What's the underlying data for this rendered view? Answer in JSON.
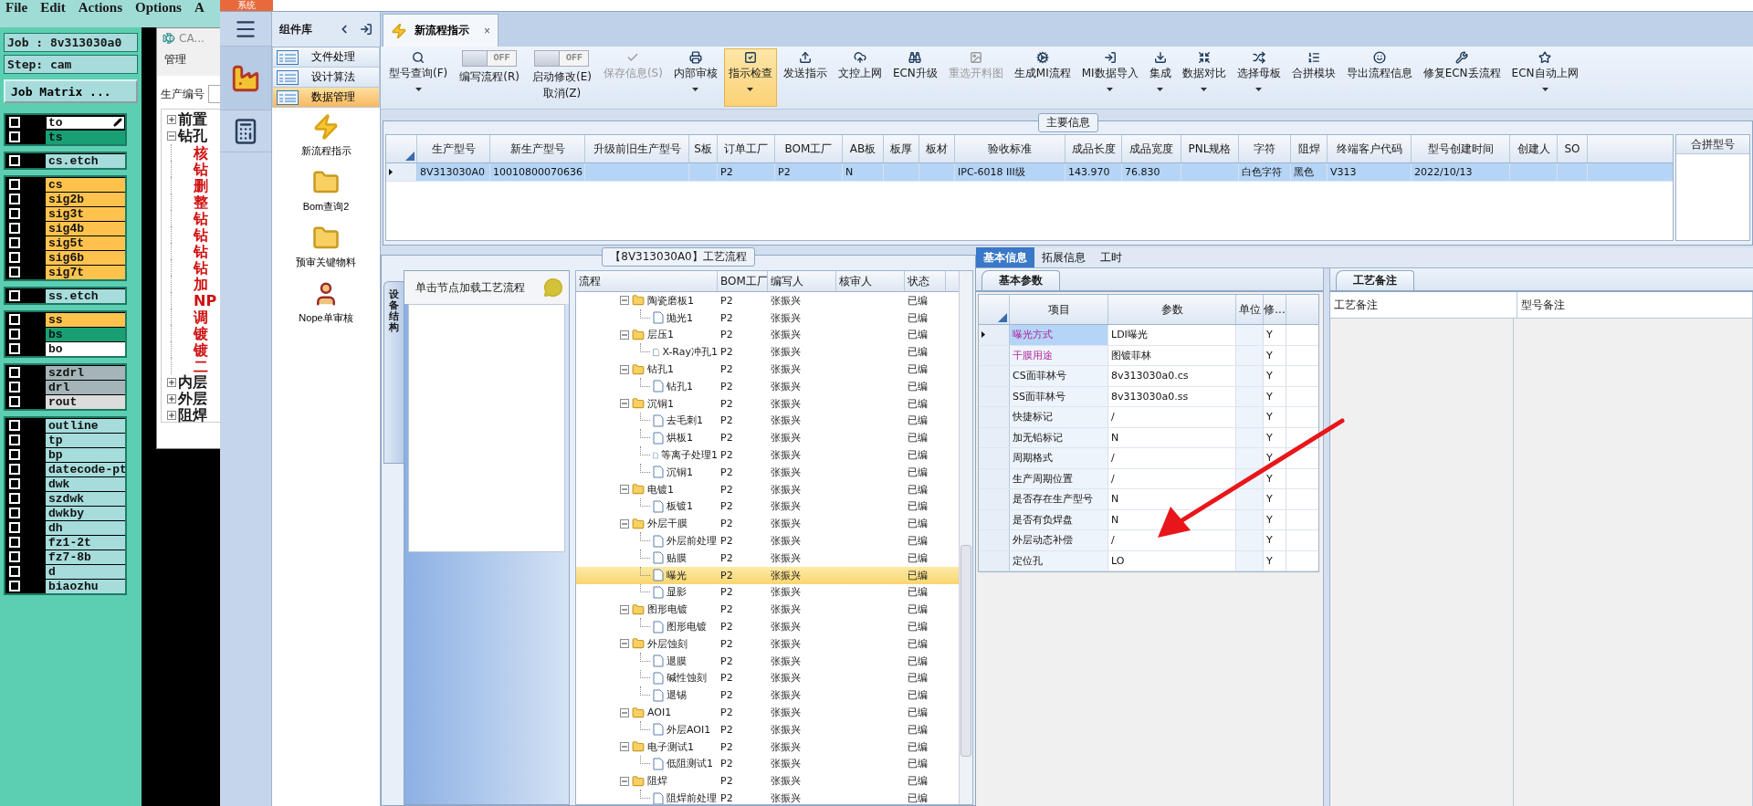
{
  "cam": {
    "menu": [
      "File",
      "Edit",
      "Actions",
      "Options",
      "A"
    ],
    "job": "Job : 8v313030a0",
    "step": "Step: cam",
    "matrix_button": "Job Matrix ...",
    "layer_groups": [
      [
        {
          "name": "to",
          "color": "#ffffff",
          "selected": true,
          "checked": false
        },
        {
          "name": "ts",
          "color": "#18a074",
          "selected": false,
          "checked": false
        }
      ],
      [
        {
          "name": "cs.etch",
          "color": "#a6dcdc",
          "selected": false,
          "checked": false
        }
      ],
      [
        {
          "name": "cs",
          "color": "#ffc34d",
          "selected": false,
          "checked": false
        },
        {
          "name": "sig2b",
          "color": "#ffc34d",
          "selected": false,
          "checked": false
        },
        {
          "name": "sig3t",
          "color": "#ffc34d",
          "selected": false,
          "checked": false
        },
        {
          "name": "sig4b",
          "color": "#ffc34d",
          "selected": false,
          "checked": false
        },
        {
          "name": "sig5t",
          "color": "#ffc34d",
          "selected": false,
          "checked": false
        },
        {
          "name": "sig6b",
          "color": "#ffc34d",
          "selected": false,
          "checked": false
        },
        {
          "name": "sig7t",
          "color": "#ffc34d",
          "selected": false,
          "checked": false
        }
      ],
      [
        {
          "name": "ss.etch",
          "color": "#a6dcdc",
          "selected": false,
          "checked": false
        }
      ],
      [
        {
          "name": "ss",
          "color": "#ffc34d",
          "selected": false,
          "checked": false
        },
        {
          "name": "bs",
          "color": "#18a074",
          "selected": false,
          "checked": false
        },
        {
          "name": "bo",
          "color": "#ffffff",
          "selected": false,
          "checked": false
        }
      ],
      [
        {
          "name": "szdrl",
          "color": "#a4b4b8",
          "selected": false,
          "checked": false
        },
        {
          "name": "drl",
          "color": "#a4b4b8",
          "selected": false,
          "checked": false
        },
        {
          "name": "rout",
          "color": "#dcdcdc",
          "selected": false,
          "checked": false
        }
      ],
      [
        {
          "name": "outline",
          "color": "#a6dcdc",
          "selected": false,
          "checked": false
        },
        {
          "name": "tp",
          "color": "#a6dcdc",
          "selected": false,
          "checked": false
        },
        {
          "name": "bp",
          "color": "#a6dcdc",
          "selected": false,
          "checked": false
        },
        {
          "name": "datecode-pt",
          "color": "#a6dcdc",
          "selected": false,
          "checked": false
        },
        {
          "name": "dwk",
          "color": "#a6dcdc",
          "selected": false,
          "checked": false
        },
        {
          "name": "szdwk",
          "color": "#a6dcdc",
          "selected": false,
          "checked": false
        },
        {
          "name": "dwkby",
          "color": "#a6dcdc",
          "selected": false,
          "checked": false
        },
        {
          "name": "dh",
          "color": "#a6dcdc",
          "selected": false,
          "checked": false
        },
        {
          "name": "fz1-2t",
          "color": "#a6dcdc",
          "selected": false,
          "checked": false
        },
        {
          "name": "fz7-8b",
          "color": "#a6dcdc",
          "selected": false,
          "checked": false
        },
        {
          "name": "d",
          "color": "#a6dcdc",
          "selected": false,
          "checked": false
        },
        {
          "name": "biaozhu",
          "color": "#a6dcdc",
          "selected": false,
          "checked": false
        }
      ]
    ]
  },
  "cam_window": {
    "title": "CA...",
    "menu": [
      "管理"
    ],
    "field_label": "生产编号",
    "tree": [
      {
        "label": "前置",
        "expanded": false
      },
      {
        "label": "钻孔",
        "expanded": true,
        "children": [
          "核",
          "钻",
          "删",
          "整",
          "钻",
          "钻",
          "钻",
          "钻",
          "加",
          "NP",
          "调",
          "镀",
          "镀",
          "二"
        ]
      },
      {
        "label": "内层",
        "expanded": false
      },
      {
        "label": "外层",
        "expanded": false
      },
      {
        "label": "阻焊",
        "expanded": false
      }
    ]
  },
  "system_tab": "系统",
  "component_panel": {
    "title": "组件库",
    "sections": [
      {
        "label": "文件处理",
        "selected": false
      },
      {
        "label": "设计算法",
        "selected": false
      },
      {
        "label": "数据管理",
        "selected": true
      }
    ],
    "items": [
      {
        "label": "新流程指示",
        "kind": "bolt"
      },
      {
        "label": "Bom查询2",
        "kind": "folder"
      },
      {
        "label": "预审关键物料",
        "kind": "folder"
      },
      {
        "label": "Nope单审核",
        "kind": "person"
      }
    ]
  },
  "doc_tabs": [
    {
      "label": "新流程指示",
      "selected": true,
      "close": "×"
    }
  ],
  "toolbar": [
    {
      "kind": "button",
      "label": "型号查询(F)",
      "dropdown": true,
      "disabled": false,
      "selected": false
    },
    {
      "kind": "toggle",
      "on": false,
      "state_text": "OFF",
      "label": "编写流程(R)"
    },
    {
      "kind": "toggle",
      "on": false,
      "state_text": "OFF",
      "label": "启动修改(E)",
      "sub_label": "取消(Z)"
    },
    {
      "kind": "button",
      "label": "保存信息(S)",
      "dropdown": false,
      "disabled": true,
      "selected": false
    },
    {
      "kind": "button",
      "label": "内部审核",
      "dropdown": true,
      "disabled": false,
      "selected": false
    },
    {
      "kind": "button",
      "label": "指示检查",
      "dropdown": true,
      "disabled": false,
      "selected": true
    },
    {
      "kind": "button",
      "label": "发送指示",
      "dropdown": false,
      "disabled": false,
      "selected": false
    },
    {
      "kind": "button",
      "label": "文控上网",
      "dropdown": false,
      "disabled": false,
      "selected": false
    },
    {
      "kind": "button",
      "label": "ECN升级",
      "dropdown": false,
      "disabled": false,
      "selected": false
    },
    {
      "kind": "button",
      "label": "重选开料图",
      "dropdown": false,
      "disabled": true,
      "selected": false
    },
    {
      "kind": "button",
      "label": "生成MI流程",
      "dropdown": false,
      "disabled": false,
      "selected": false
    },
    {
      "kind": "button",
      "label": "MI数据导入",
      "dropdown": true,
      "disabled": false,
      "selected": false
    },
    {
      "kind": "button",
      "label": "集成",
      "dropdown": true,
      "disabled": false,
      "selected": false
    },
    {
      "kind": "button",
      "label": "数据对比",
      "dropdown": true,
      "disabled": false,
      "selected": false
    },
    {
      "kind": "button",
      "label": "选择母板",
      "dropdown": true,
      "disabled": false,
      "selected": false
    },
    {
      "kind": "button",
      "label": "合拼模块",
      "dropdown": false,
      "disabled": false,
      "selected": false
    },
    {
      "kind": "button",
      "label": "导出流程信息",
      "dropdown": false,
      "disabled": false,
      "selected": false
    },
    {
      "kind": "button",
      "label": "修复ECN丢流程",
      "dropdown": false,
      "disabled": false,
      "selected": false
    },
    {
      "kind": "button",
      "label": "ECN自动上网",
      "dropdown": true,
      "disabled": false,
      "selected": false
    }
  ],
  "main_info": {
    "title": "主要信息",
    "columns": [
      "生产型号",
      "新生产型号",
      "升级前旧生产型号",
      "S板",
      "订单工厂",
      "BOM工厂",
      "AB板",
      "板厚",
      "板材",
      "验收标准",
      "成品长度",
      "成品宽度",
      "PNL规格",
      "字符",
      "阻焊",
      "终端客户代码",
      "型号创建时间",
      "创建人",
      "SO"
    ],
    "rows": [
      {
        "selected": true,
        "cells": [
          "8V313030A0",
          "10010800070636",
          null,
          null,
          "P2",
          "P2",
          "N",
          null,
          null,
          "IPC-6018 III级",
          "143.970",
          "76.830",
          null,
          "白色字符",
          "黑色",
          "V313",
          "2022/10/13",
          null,
          null
        ]
      }
    ],
    "side_column": "合拼型号"
  },
  "process": {
    "title": "【8V313030A0】工艺流程",
    "side_tab": "设备结构",
    "hint": "单击节点加载工艺流程",
    "columns": [
      "流程",
      "BOM工厂",
      "编写人",
      "核审人",
      "状态"
    ],
    "tree": [
      {
        "label": "陶瓷磨板1",
        "bom": "P2",
        "writer": "张振兴",
        "status": "已编",
        "expanded": true,
        "selected": false,
        "children": [
          {
            "label": "抛光1",
            "bom": "P2",
            "writer": "张振兴",
            "status": "已编",
            "selected": false
          }
        ]
      },
      {
        "label": "层压1",
        "bom": "P2",
        "writer": "张振兴",
        "status": "已编",
        "expanded": true,
        "selected": false,
        "children": [
          {
            "label": "X-Ray冲孔1",
            "bom": "P2",
            "writer": "张振兴",
            "status": "已编",
            "selected": false
          }
        ]
      },
      {
        "label": "钻孔1",
        "bom": "P2",
        "writer": "张振兴",
        "status": "已编",
        "expanded": true,
        "selected": false,
        "children": [
          {
            "label": "钻孔1",
            "bom": "P2",
            "writer": "张振兴",
            "status": "已编",
            "selected": false
          }
        ]
      },
      {
        "label": "沉铜1",
        "bom": "P2",
        "writer": "张振兴",
        "status": "已编",
        "expanded": true,
        "selected": false,
        "children": [
          {
            "label": "去毛刺1",
            "bom": "P2",
            "writer": "张振兴",
            "status": "已编",
            "selected": false
          },
          {
            "label": "烘板1",
            "bom": "P2",
            "writer": "张振兴",
            "status": "已编",
            "selected": false
          },
          {
            "label": "等离子处理1",
            "bom": "P2",
            "writer": "张振兴",
            "status": "已编",
            "selected": false
          },
          {
            "label": "沉铜1",
            "bom": "P2",
            "writer": "张振兴",
            "status": "已编",
            "selected": false
          }
        ]
      },
      {
        "label": "电镀1",
        "bom": "P2",
        "writer": "张振兴",
        "status": "已编",
        "expanded": true,
        "selected": false,
        "children": [
          {
            "label": "板镀1",
            "bom": "P2",
            "writer": "张振兴",
            "status": "已编",
            "selected": false
          }
        ]
      },
      {
        "label": "外层干膜",
        "bom": "P2",
        "writer": "张振兴",
        "status": "已编",
        "expanded": true,
        "selected": false,
        "children": [
          {
            "label": "外层前处理",
            "bom": "P2",
            "writer": "张振兴",
            "status": "已编",
            "selected": false
          },
          {
            "label": "贴膜",
            "bom": "P2",
            "writer": "张振兴",
            "status": "已编",
            "selected": false
          },
          {
            "label": "曝光",
            "bom": "P2",
            "writer": "张振兴",
            "status": "已编",
            "selected": true
          },
          {
            "label": "显影",
            "bom": "P2",
            "writer": "张振兴",
            "status": "已编",
            "selected": false
          }
        ]
      },
      {
        "label": "图形电镀",
        "bom": "P2",
        "writer": "张振兴",
        "status": "已编",
        "expanded": true,
        "selected": false,
        "children": [
          {
            "label": "图形电镀",
            "bom": "P2",
            "writer": "张振兴",
            "status": "已编",
            "selected": false
          }
        ]
      },
      {
        "label": "外层蚀刻",
        "bom": "P2",
        "writer": "张振兴",
        "status": "已编",
        "expanded": true,
        "selected": false,
        "children": [
          {
            "label": "退膜",
            "bom": "P2",
            "writer": "张振兴",
            "status": "已编",
            "selected": false
          },
          {
            "label": "碱性蚀刻",
            "bom": "P2",
            "writer": "张振兴",
            "status": "已编",
            "selected": false
          },
          {
            "label": "退锡",
            "bom": "P2",
            "writer": "张振兴",
            "status": "已编",
            "selected": false
          }
        ]
      },
      {
        "label": "AOI1",
        "bom": "P2",
        "writer": "张振兴",
        "status": "已编",
        "expanded": true,
        "selected": false,
        "children": [
          {
            "label": "外层AOI1",
            "bom": "P2",
            "writer": "张振兴",
            "status": "已编",
            "selected": false
          }
        ]
      },
      {
        "label": "电子测试1",
        "bom": "P2",
        "writer": "张振兴",
        "status": "已编",
        "expanded": true,
        "selected": false,
        "children": [
          {
            "label": "低阻测试1",
            "bom": "P2",
            "writer": "张振兴",
            "status": "已编",
            "selected": false
          }
        ]
      },
      {
        "label": "阻焊",
        "bom": "P2",
        "writer": "张振兴",
        "status": "已编",
        "expanded": true,
        "selected": false,
        "children": [
          {
            "label": "阻焊前处理",
            "bom": "P2",
            "writer": "张振兴",
            "status": "已编",
            "selected": false
          }
        ]
      }
    ]
  },
  "detail_tabs": [
    {
      "label": "基本信息",
      "selected": true
    },
    {
      "label": "拓展信息",
      "selected": false
    },
    {
      "label": "工时",
      "selected": false
    }
  ],
  "params": {
    "tab": "基本参数",
    "columns": [
      "项目",
      "参数",
      "单位",
      "修..."
    ],
    "rows": [
      {
        "item": "曝光方式",
        "value": "LDI曝光",
        "modify": "Y",
        "flagged": true,
        "selected": true
      },
      {
        "item": "干膜用途",
        "value": "图镀菲林",
        "modify": "Y",
        "flagged": true,
        "selected": false
      },
      {
        "item": "CS面菲林号",
        "value": "8v313030a0.cs",
        "modify": "Y",
        "flagged": false,
        "selected": false
      },
      {
        "item": "SS面菲林号",
        "value": "8v313030a0.ss",
        "modify": "Y",
        "flagged": false,
        "selected": false
      },
      {
        "item": "快捷标记",
        "value": "/",
        "modify": "Y",
        "flagged": false,
        "selected": false
      },
      {
        "item": "加无铅标记",
        "value": "N",
        "modify": "Y",
        "flagged": false,
        "selected": false
      },
      {
        "item": "周期格式",
        "value": "/",
        "modify": "Y",
        "flagged": false,
        "selected": false
      },
      {
        "item": "生产周期位置",
        "value": "/",
        "modify": "Y",
        "flagged": false,
        "selected": false
      },
      {
        "item": "是否存在生产型号",
        "value": "N",
        "modify": "Y",
        "flagged": false,
        "selected": false
      },
      {
        "item": "是否有负焊盘",
        "value": "N",
        "modify": "Y",
        "flagged": false,
        "selected": false
      },
      {
        "item": "外层动态补偿",
        "value": "/",
        "modify": "Y",
        "flagged": false,
        "selected": false
      },
      {
        "item": "定位孔",
        "value": "LO",
        "modify": "Y",
        "flagged": false,
        "selected": false
      }
    ]
  },
  "notes": {
    "tab": "工艺备注",
    "columns": [
      "工艺备注",
      "型号备注"
    ]
  }
}
